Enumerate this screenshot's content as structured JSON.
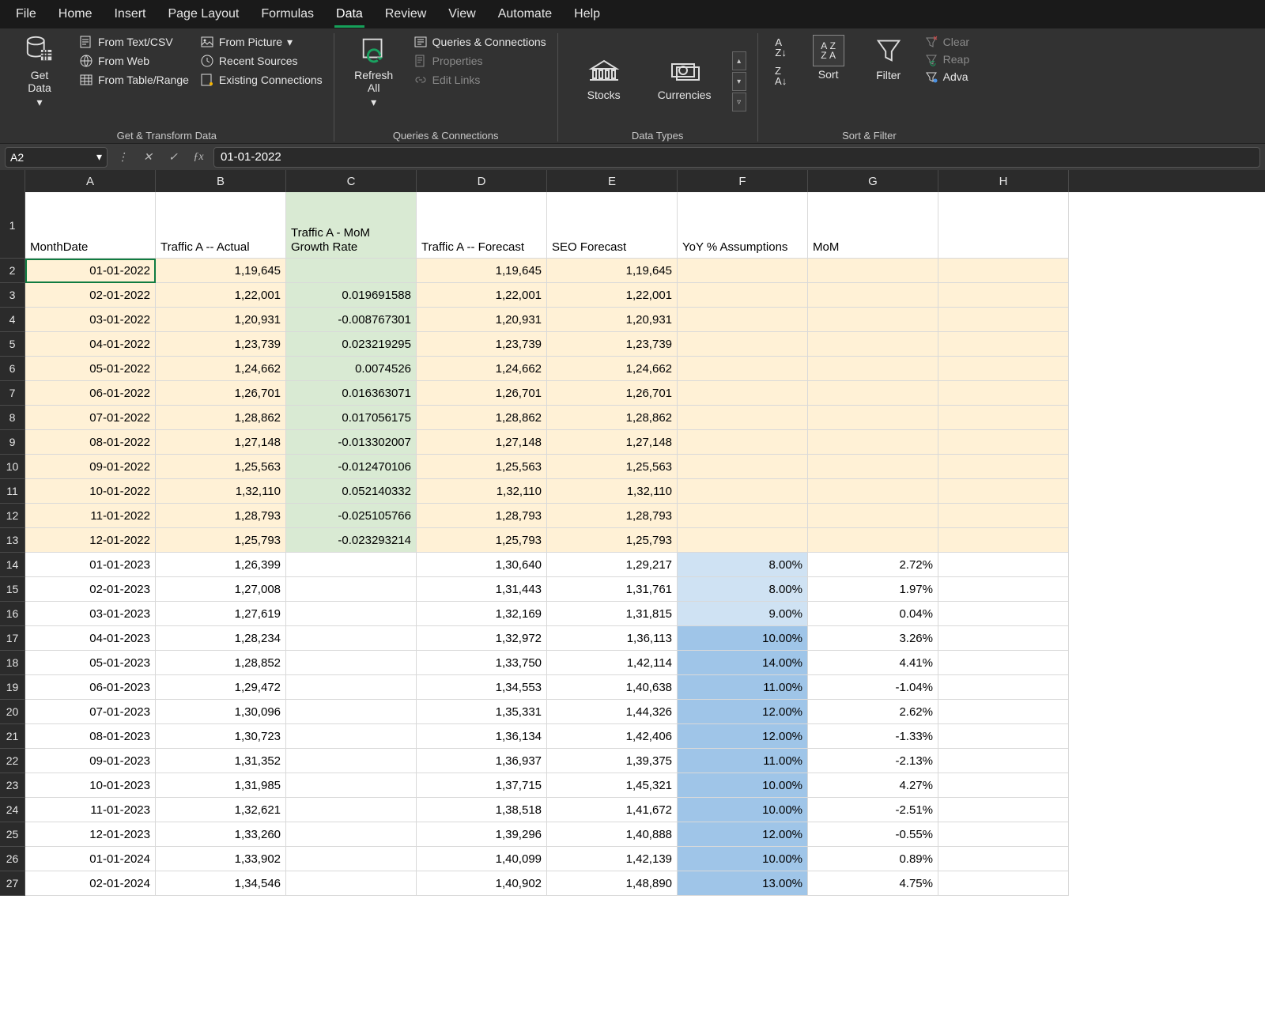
{
  "menu": {
    "file": "File",
    "home": "Home",
    "insert": "Insert",
    "page_layout": "Page Layout",
    "formulas": "Formulas",
    "data": "Data",
    "review": "Review",
    "view": "View",
    "automate": "Automate",
    "help": "Help",
    "active": "data"
  },
  "ribbon": {
    "get_data": "Get\nData",
    "from_text_csv": "From Text/CSV",
    "from_web": "From Web",
    "from_table_range": "From Table/Range",
    "from_picture": "From Picture",
    "recent_sources": "Recent Sources",
    "existing_connections": "Existing Connections",
    "group_get_transform": "Get & Transform Data",
    "refresh_all": "Refresh\nAll",
    "queries_connections": "Queries & Connections",
    "properties": "Properties",
    "edit_links": "Edit Links",
    "group_queries": "Queries & Connections",
    "stocks": "Stocks",
    "currencies": "Currencies",
    "group_data_types": "Data Types",
    "sort": "Sort",
    "filter": "Filter",
    "clear": "Clear",
    "reapply": "Reap",
    "advanced": "Adva",
    "group_sort_filter": "Sort & Filter"
  },
  "formula_bar": {
    "cell_ref": "A2",
    "value": "01-01-2022"
  },
  "columns": [
    "A",
    "B",
    "C",
    "D",
    "E",
    "F",
    "G",
    "H"
  ],
  "headers": {
    "A": "MonthDate",
    "B": "Traffic A -- Actual",
    "C": "Traffic A - MoM Growth Rate",
    "D": "Traffic A -- Forecast",
    "E": "SEO Forecast",
    "F": "YoY % Assumptions",
    "G": "MoM",
    "H": ""
  },
  "rows": [
    {
      "n": 2,
      "cream": true,
      "A": "01-01-2022",
      "B": "1,19,645",
      "C": "",
      "D": "1,19,645",
      "E": "1,19,645",
      "F": "",
      "G": ""
    },
    {
      "n": 3,
      "cream": true,
      "A": "02-01-2022",
      "B": "1,22,001",
      "C": "0.019691588",
      "D": "1,22,001",
      "E": "1,22,001",
      "F": "",
      "G": ""
    },
    {
      "n": 4,
      "cream": true,
      "A": "03-01-2022",
      "B": "1,20,931",
      "C": "-0.008767301",
      "D": "1,20,931",
      "E": "1,20,931",
      "F": "",
      "G": ""
    },
    {
      "n": 5,
      "cream": true,
      "A": "04-01-2022",
      "B": "1,23,739",
      "C": "0.023219295",
      "D": "1,23,739",
      "E": "1,23,739",
      "F": "",
      "G": ""
    },
    {
      "n": 6,
      "cream": true,
      "A": "05-01-2022",
      "B": "1,24,662",
      "C": "0.0074526",
      "D": "1,24,662",
      "E": "1,24,662",
      "F": "",
      "G": ""
    },
    {
      "n": 7,
      "cream": true,
      "A": "06-01-2022",
      "B": "1,26,701",
      "C": "0.016363071",
      "D": "1,26,701",
      "E": "1,26,701",
      "F": "",
      "G": ""
    },
    {
      "n": 8,
      "cream": true,
      "A": "07-01-2022",
      "B": "1,28,862",
      "C": "0.017056175",
      "D": "1,28,862",
      "E": "1,28,862",
      "F": "",
      "G": ""
    },
    {
      "n": 9,
      "cream": true,
      "A": "08-01-2022",
      "B": "1,27,148",
      "C": "-0.013302007",
      "D": "1,27,148",
      "E": "1,27,148",
      "F": "",
      "G": ""
    },
    {
      "n": 10,
      "cream": true,
      "A": "09-01-2022",
      "B": "1,25,563",
      "C": "-0.012470106",
      "D": "1,25,563",
      "E": "1,25,563",
      "F": "",
      "G": ""
    },
    {
      "n": 11,
      "cream": true,
      "A": "10-01-2022",
      "B": "1,32,110",
      "C": "0.052140332",
      "D": "1,32,110",
      "E": "1,32,110",
      "F": "",
      "G": ""
    },
    {
      "n": 12,
      "cream": true,
      "A": "11-01-2022",
      "B": "1,28,793",
      "C": "-0.025105766",
      "D": "1,28,793",
      "E": "1,28,793",
      "F": "",
      "G": ""
    },
    {
      "n": 13,
      "cream": true,
      "A": "12-01-2022",
      "B": "1,25,793",
      "C": "-0.023293214",
      "D": "1,25,793",
      "E": "1,25,793",
      "F": "",
      "G": ""
    },
    {
      "n": 14,
      "A": "01-01-2023",
      "B": "1,26,399",
      "C": "",
      "D": "1,30,640",
      "E": "1,29,217",
      "F": "8.00%",
      "Fb": "b1",
      "G": "2.72%"
    },
    {
      "n": 15,
      "A": "02-01-2023",
      "B": "1,27,008",
      "C": "",
      "D": "1,31,443",
      "E": "1,31,761",
      "F": "8.00%",
      "Fb": "b1",
      "G": "1.97%"
    },
    {
      "n": 16,
      "A": "03-01-2023",
      "B": "1,27,619",
      "C": "",
      "D": "1,32,169",
      "E": "1,31,815",
      "F": "9.00%",
      "Fb": "b1",
      "G": "0.04%"
    },
    {
      "n": 17,
      "A": "04-01-2023",
      "B": "1,28,234",
      "C": "",
      "D": "1,32,972",
      "E": "1,36,113",
      "F": "10.00%",
      "Fb": "b2",
      "G": "3.26%"
    },
    {
      "n": 18,
      "A": "05-01-2023",
      "B": "1,28,852",
      "C": "",
      "D": "1,33,750",
      "E": "1,42,114",
      "F": "14.00%",
      "Fb": "b2",
      "G": "4.41%"
    },
    {
      "n": 19,
      "A": "06-01-2023",
      "B": "1,29,472",
      "C": "",
      "D": "1,34,553",
      "E": "1,40,638",
      "F": "11.00%",
      "Fb": "b2",
      "G": "-1.04%"
    },
    {
      "n": 20,
      "A": "07-01-2023",
      "B": "1,30,096",
      "C": "",
      "D": "1,35,331",
      "E": "1,44,326",
      "F": "12.00%",
      "Fb": "b2",
      "G": "2.62%"
    },
    {
      "n": 21,
      "A": "08-01-2023",
      "B": "1,30,723",
      "C": "",
      "D": "1,36,134",
      "E": "1,42,406",
      "F": "12.00%",
      "Fb": "b2",
      "G": "-1.33%"
    },
    {
      "n": 22,
      "A": "09-01-2023",
      "B": "1,31,352",
      "C": "",
      "D": "1,36,937",
      "E": "1,39,375",
      "F": "11.00%",
      "Fb": "b2",
      "G": "-2.13%"
    },
    {
      "n": 23,
      "A": "10-01-2023",
      "B": "1,31,985",
      "C": "",
      "D": "1,37,715",
      "E": "1,45,321",
      "F": "10.00%",
      "Fb": "b2",
      "G": "4.27%"
    },
    {
      "n": 24,
      "A": "11-01-2023",
      "B": "1,32,621",
      "C": "",
      "D": "1,38,518",
      "E": "1,41,672",
      "F": "10.00%",
      "Fb": "b2",
      "G": "-2.51%"
    },
    {
      "n": 25,
      "A": "12-01-2023",
      "B": "1,33,260",
      "C": "",
      "D": "1,39,296",
      "E": "1,40,888",
      "F": "12.00%",
      "Fb": "b2",
      "G": "-0.55%"
    },
    {
      "n": 26,
      "A": "01-01-2024",
      "B": "1,33,902",
      "C": "",
      "D": "1,40,099",
      "E": "1,42,139",
      "F": "10.00%",
      "Fb": "b2",
      "G": "0.89%"
    },
    {
      "n": 27,
      "A": "02-01-2024",
      "B": "1,34,546",
      "C": "",
      "D": "1,40,902",
      "E": "1,48,890",
      "F": "13.00%",
      "Fb": "b2",
      "G": "4.75%"
    }
  ]
}
